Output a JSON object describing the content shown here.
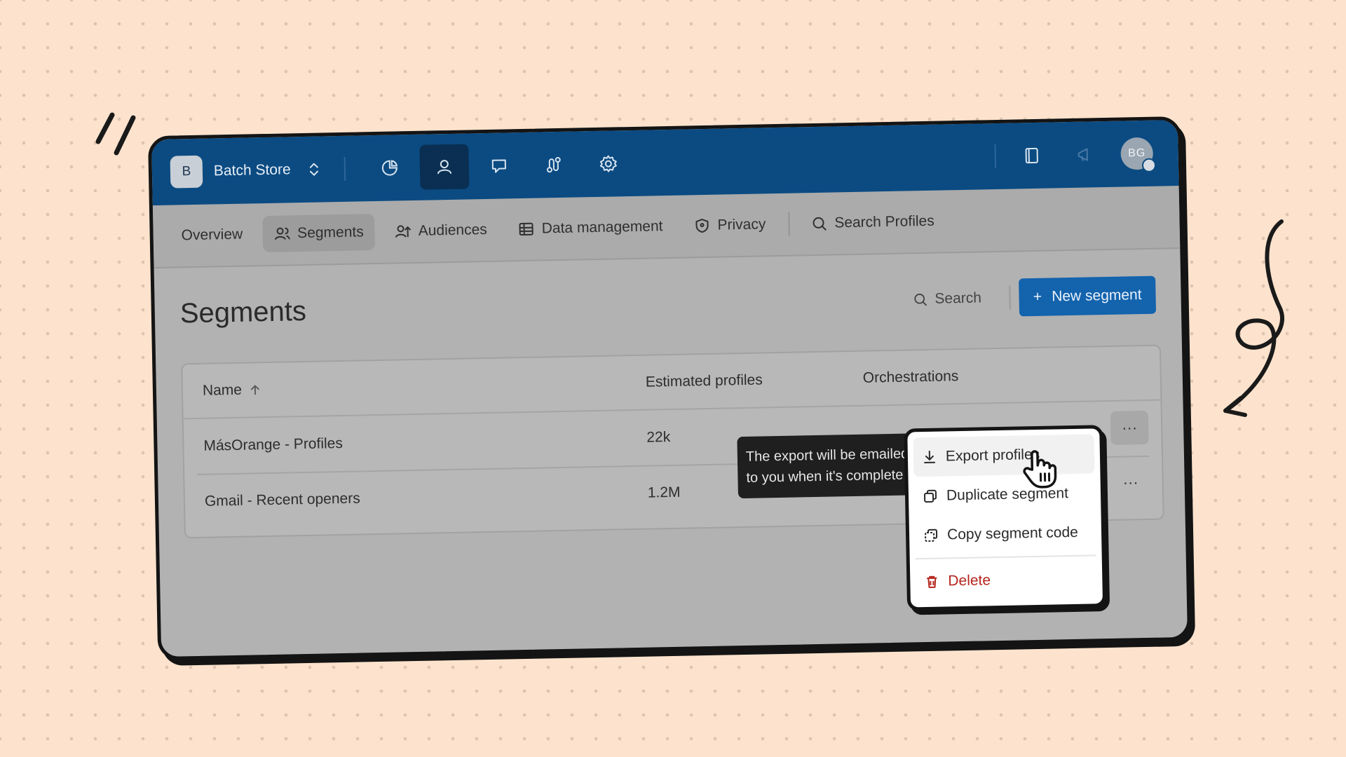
{
  "app": {
    "store_initial": "B",
    "store_name": "Batch Store",
    "user_initials": "BG"
  },
  "topnav": [
    {
      "icon": "analytics-icon"
    },
    {
      "icon": "profiles-icon",
      "active": true
    },
    {
      "icon": "messages-icon"
    },
    {
      "icon": "automations-icon"
    },
    {
      "icon": "settings-icon"
    }
  ],
  "subnav": {
    "overview": "Overview",
    "segments": "Segments",
    "audiences": "Audiences",
    "data_management": "Data management",
    "privacy": "Privacy",
    "search_profiles": "Search Profiles"
  },
  "page": {
    "title": "Segments",
    "search_label": "Search",
    "new_button": "New segment"
  },
  "table": {
    "headers": {
      "name": "Name",
      "estimated": "Estimated profiles",
      "orchestrations": "Orchestrations"
    },
    "rows": [
      {
        "name": "MásOrange - Profiles",
        "estimated": "22k",
        "orchestrations": ""
      },
      {
        "name": "Gmail - Recent openers",
        "estimated": "1.2M",
        "orchestrations": "-"
      }
    ],
    "more_label": "···"
  },
  "tooltip": {
    "text": "The export will be emailed to you when it's complete"
  },
  "menu": {
    "export": "Export profiles",
    "duplicate": "Duplicate segment",
    "copy_code": "Copy segment code",
    "delete": "Delete"
  },
  "colors": {
    "background": "#fde3cd",
    "topbar": "#0b4b82",
    "accent": "#1363ad",
    "danger": "#b5261e"
  }
}
